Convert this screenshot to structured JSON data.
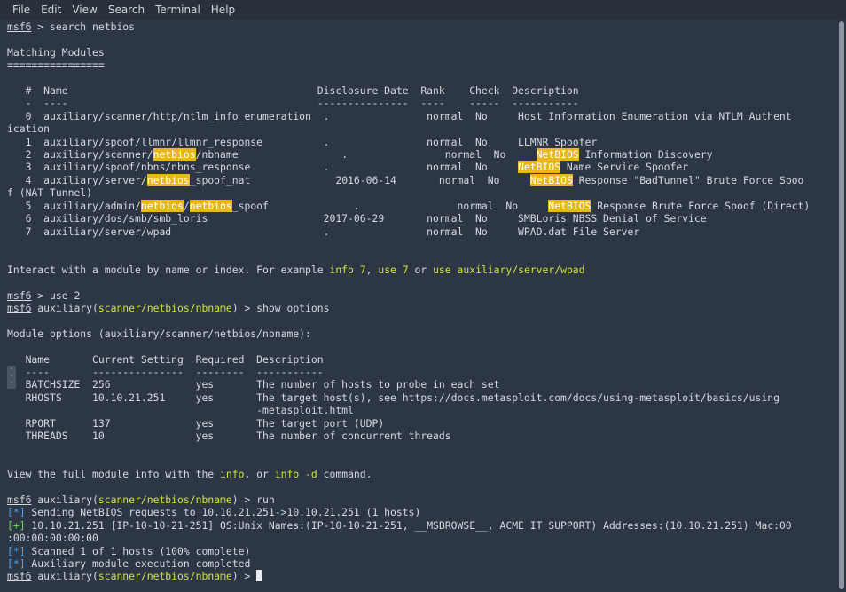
{
  "menu": [
    "File",
    "Edit",
    "View",
    "Search",
    "Terminal",
    "Help"
  ],
  "terminal": {
    "lines": [
      [
        {
          "t": "msf6",
          "c": "prompt"
        },
        {
          "t": " > search netbios"
        }
      ],
      [],
      [
        {
          "t": "Matching Modules"
        }
      ],
      [
        {
          "t": "================"
        }
      ],
      [],
      [
        {
          "t": "   #  Name                                         Disclosure Date  Rank    Check  Description"
        }
      ],
      [
        {
          "t": "   -  ----                                         ---------------  ----    -----  -----------"
        }
      ],
      [
        {
          "t": "   0  auxiliary/scanner/http/ntlm_info_enumeration  .                normal  No     Host Information Enumeration via NTLM Authent"
        }
      ],
      [
        {
          "t": "ication"
        }
      ],
      [
        {
          "t": "   1  auxiliary/spoof/llmnr/llmnr_response          .                normal  No     LLMNR Spoofer"
        }
      ],
      [
        {
          "t": "   2  auxiliary/scanner/"
        },
        {
          "t": "netbios",
          "c": "hl"
        },
        {
          "t": "/nbname                 .                normal  No     "
        },
        {
          "t": "NetBIOS",
          "c": "hl"
        },
        {
          "t": " Information Discovery"
        }
      ],
      [
        {
          "t": "   3  auxiliary/spoof/nbns/nbns_response            .                normal  No     "
        },
        {
          "t": "NetBIOS",
          "c": "hl"
        },
        {
          "t": " Name Service Spoofer"
        }
      ],
      [
        {
          "t": "   4  auxiliary/server/"
        },
        {
          "t": "netbios",
          "c": "hl"
        },
        {
          "t": "_spoof_nat              2016-06-14       normal  No     "
        },
        {
          "t": "NetBIOS",
          "c": "hl"
        },
        {
          "t": " Response \"BadTunnel\" Brute Force Spoo"
        }
      ],
      [
        {
          "t": "f (NAT Tunnel)"
        }
      ],
      [
        {
          "t": "   5  auxiliary/admin/"
        },
        {
          "t": "netbios",
          "c": "hl"
        },
        {
          "t": "/"
        },
        {
          "t": "netbios",
          "c": "hl"
        },
        {
          "t": "_spoof              .                normal  No     "
        },
        {
          "t": "NetBIOS",
          "c": "hl"
        },
        {
          "t": " Response Brute Force Spoof (Direct)"
        }
      ],
      [
        {
          "t": "   6  auxiliary/dos/smb/smb_loris                   2017-06-29       normal  No     SMBLoris NBSS Denial of Service"
        }
      ],
      [
        {
          "t": "   7  auxiliary/server/wpad                         .                normal  No     WPAD.dat File Server"
        }
      ],
      [],
      [],
      [
        {
          "t": "Interact with a module by name or index. For example "
        },
        {
          "t": "info 7",
          "c": "green"
        },
        {
          "t": ", "
        },
        {
          "t": "use 7",
          "c": "green"
        },
        {
          "t": " or "
        },
        {
          "t": "use auxiliary/server/wpad",
          "c": "green"
        }
      ],
      [],
      [
        {
          "t": "msf6",
          "c": "prompt"
        },
        {
          "t": " > use 2"
        }
      ],
      [
        {
          "t": "msf6",
          "c": "prompt"
        },
        {
          "t": " auxiliary("
        },
        {
          "t": "scanner/netbios/nbname",
          "c": "green"
        },
        {
          "t": ") > show options"
        }
      ],
      [],
      [
        {
          "t": "Module options (auxiliary/scanner/netbios/nbname):"
        }
      ],
      [],
      [
        {
          "t": "   Name       Current Setting  Required  Description"
        }
      ],
      [
        {
          "t": "   ----       ---------------  --------  -----------"
        }
      ],
      [
        {
          "t": "   BATCHSIZE  256              yes       The number of hosts to probe in each set"
        }
      ],
      [
        {
          "t": "   RHOSTS     10.10.21.251     yes       The target host(s), see https://docs.metasploit.com/docs/using-metasploit/basics/using"
        }
      ],
      [
        {
          "t": "                                         -metasploit.html"
        }
      ],
      [
        {
          "t": "   RPORT      137              yes       The target port (UDP)"
        }
      ],
      [
        {
          "t": "   THREADS    10               yes       The number of concurrent threads"
        }
      ],
      [],
      [],
      [
        {
          "t": "View the full module info with the "
        },
        {
          "t": "info",
          "c": "green"
        },
        {
          "t": ", or "
        },
        {
          "t": "info -d",
          "c": "green"
        },
        {
          "t": " command."
        }
      ],
      [],
      [
        {
          "t": "msf6",
          "c": "prompt"
        },
        {
          "t": " auxiliary("
        },
        {
          "t": "scanner/netbios/nbname",
          "c": "green"
        },
        {
          "t": ") > run"
        }
      ],
      [
        {
          "t": "[*]",
          "c": "blue"
        },
        {
          "t": " Sending NetBIOS requests to 10.10.21.251->10.10.21.251 (1 hosts)"
        }
      ],
      [
        {
          "t": "[+]",
          "c": "plus"
        },
        {
          "t": " 10.10.21.251 [IP-10-10-21-251] OS:Unix Names:(IP-10-10-21-251, __MSBROWSE__, ACME IT SUPPORT) Addresses:(10.10.21.251) Mac:00"
        }
      ],
      [
        {
          "t": ":00:00:00:00:00"
        }
      ],
      [
        {
          "t": "[*]",
          "c": "blue"
        },
        {
          "t": " Scanned 1 of 1 hosts (100% complete)"
        }
      ],
      [
        {
          "t": "[*]",
          "c": "blue"
        },
        {
          "t": " Auxiliary module execution completed"
        }
      ],
      [
        {
          "t": "msf6",
          "c": "prompt"
        },
        {
          "t": " auxiliary("
        },
        {
          "t": "scanner/netbios/nbname",
          "c": "green"
        },
        {
          "t": ") > "
        },
        {
          "t": "",
          "c": "cursor"
        }
      ]
    ]
  }
}
